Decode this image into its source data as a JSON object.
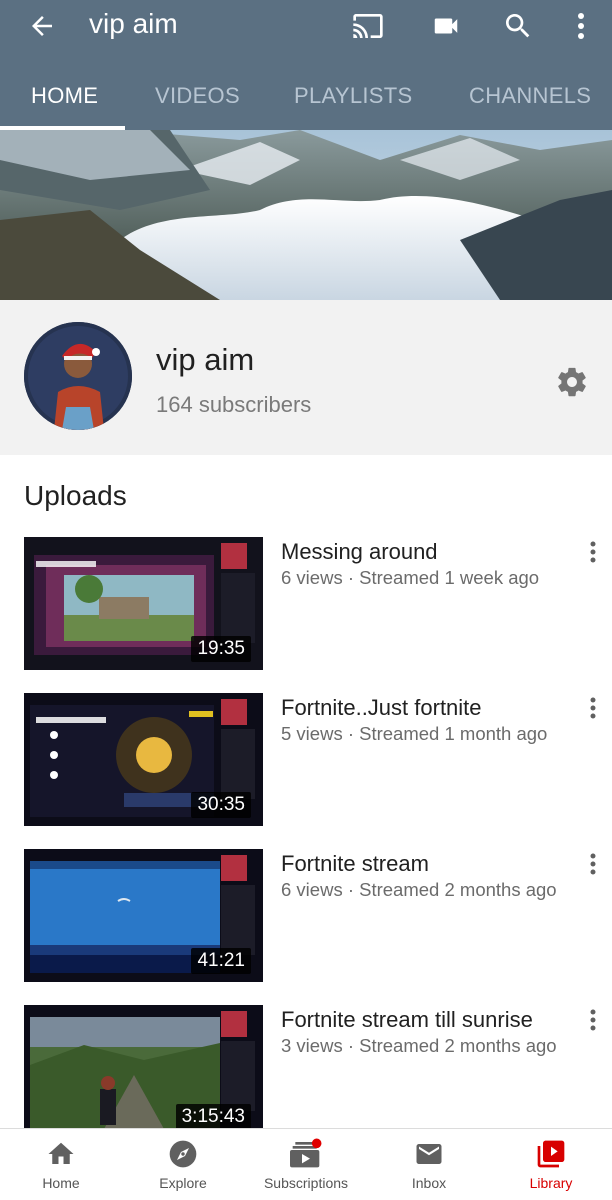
{
  "app_bar": {
    "title": "vip aim",
    "icons": [
      "back-arrow-icon",
      "cast-icon",
      "video-camera-icon",
      "search-icon",
      "more-vert-icon"
    ]
  },
  "tabs": [
    {
      "label": "HOME",
      "active": true
    },
    {
      "label": "VIDEOS",
      "active": false
    },
    {
      "label": "PLAYLISTS",
      "active": false
    },
    {
      "label": "CHANNELS",
      "active": false
    }
  ],
  "channel": {
    "name": "vip aim",
    "subscribers": "164 subscribers"
  },
  "uploads": {
    "heading": "Uploads",
    "videos": [
      {
        "title": "Messing around",
        "meta": "6 views · Streamed 1 week ago",
        "duration": "19:35"
      },
      {
        "title": "Fortnite..Just fortnite",
        "meta": "5 views · Streamed 1 month ago",
        "duration": "30:35"
      },
      {
        "title": "Fortnite stream",
        "meta": "6 views · Streamed 2 months ago",
        "duration": "41:21"
      },
      {
        "title": "Fortnite stream till sunrise",
        "meta": "3 views · Streamed 2 months ago",
        "duration": "3:15:43"
      }
    ]
  },
  "bottom_nav": [
    {
      "label": "Home",
      "icon": "home-icon",
      "active": false
    },
    {
      "label": "Explore",
      "icon": "compass-icon",
      "active": false
    },
    {
      "label": "Subscriptions",
      "icon": "subscriptions-icon",
      "active": false,
      "badge": true
    },
    {
      "label": "Inbox",
      "icon": "inbox-mail-icon",
      "active": false
    },
    {
      "label": "Library",
      "icon": "library-icon",
      "active": true
    }
  ],
  "colors": {
    "app_bar": "#5b7082",
    "accent_red": "#d80000",
    "tab_inactive": "#b7c5d2"
  }
}
